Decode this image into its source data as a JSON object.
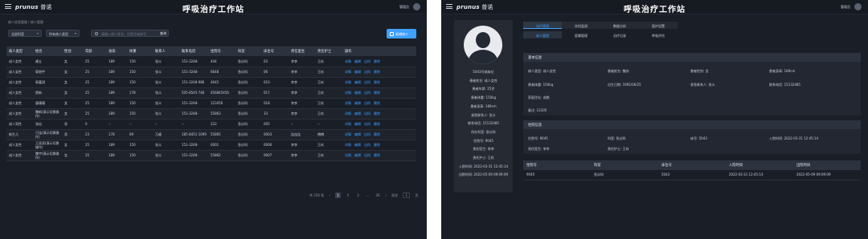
{
  "app": {
    "logo_main": "prunus",
    "logo_sub": "普诺",
    "title": "呼吸治疗工作站",
    "user": "管理员"
  },
  "list_page": {
    "breadcrumb": "病人信息管理 / 病人管理",
    "filter_dept": "全部科室",
    "filter_type": "所有病人类型",
    "search_placeholder": "请输入病人姓名、住院号或床号",
    "search_button": "查询",
    "add_button": "新增病人",
    "columns": [
      "病人类型",
      "姓名",
      "性别",
      "年龄",
      "身高",
      "体重",
      "联系人",
      "联系电话",
      "住院号",
      "科室",
      "床位号",
      "责任医生",
      "责任护士",
      "操作"
    ],
    "ops": [
      "详情",
      "编辑",
      "出科",
      "删除"
    ],
    "rows": [
      [
        "成人女性",
        "康五",
        "女",
        "25",
        "189",
        "150",
        "张义",
        "151-3248-",
        "444",
        "急诊科",
        "03",
        "李李",
        "王玖"
      ],
      [
        "成人女性",
        "郭朋宇",
        "女",
        "25",
        "189",
        "150",
        "张义",
        "151-3248-",
        "6648",
        "急诊科",
        "06",
        "李李",
        "王玖"
      ],
      [
        "成人女性",
        "郭嘉琪",
        "女",
        "25",
        "189",
        "150",
        "张义",
        "151-3248-986",
        "4645",
        "急诊科",
        "010",
        "李李",
        "王玖"
      ],
      [
        "成人女性",
        "贾新",
        "女",
        "25",
        "189",
        "178",
        "张义",
        "505-8545-746",
        "456845456",
        "急诊科",
        "017",
        "李李",
        "王玖"
      ],
      [
        "成人女性",
        "唐珊珊",
        "女",
        "25",
        "189",
        "150",
        "张义",
        "151-3248-",
        "123456",
        "急诊科",
        "018",
        "李李",
        "王玖"
      ],
      [
        "成人女性",
        "魏新(演示切换操作)",
        "女",
        "25",
        "189",
        "150",
        "张义",
        "151-3248-",
        "55863",
        "急诊科",
        "33",
        "李李",
        "王玖"
      ],
      [
        "成人男性",
        "张仙",
        "男",
        "0",
        "--",
        "--",
        "--",
        "--",
        "222",
        "急诊科",
        "005",
        "--",
        "--"
      ],
      [
        "新生儿",
        "只连(演示切换操作)",
        "男",
        "23",
        "178",
        "69",
        "万顺",
        "185-8451-1099",
        "55865",
        "急诊科",
        "0003",
        "连连连",
        "傅傅"
      ],
      [
        "成人女性",
        "王双双(演示切换操作)",
        "女",
        "25",
        "189",
        "150",
        "张义",
        "151-3248-",
        "0001",
        "急诊科",
        "0006",
        "李李",
        "王玖"
      ],
      [
        "成人女性",
        "魏宇(演示切换操作)",
        "女",
        "25",
        "189",
        "150",
        "张义",
        "151-3248-",
        "55862",
        "急诊科",
        "0007",
        "李李",
        "王玖"
      ]
    ],
    "pager": {
      "total": "共 256 条",
      "prev": "‹",
      "pages": [
        "1",
        "2",
        "3",
        "...",
        "26"
      ],
      "current": "1",
      "next": "›",
      "goto_label": "前往",
      "goto_value": "1",
      "goto_suffix": "页"
    }
  },
  "detail_page": {
    "profile": [
      "5043号病床位",
      "患者姓名: 成人女性",
      "患者年龄: 25岁",
      "患者体重: 150kg",
      "患者身高: 189cm",
      "紧急联系人: 张义",
      "联系电话: 15132485",
      "所在科室: 急诊科",
      "住院号: 9045",
      "责任医生: 李李",
      "责任护士: 王玖",
      "入院时间: 2022-03-31 12:45:14",
      "出院时间: 2022-05-09 09:09:09"
    ],
    "tabs_top": [
      "治疗管理",
      "实时监测",
      "数据分析",
      "医护设置"
    ],
    "tabs_sub": [
      "病人管理",
      "医嘱管理",
      "治疗记录",
      "呼吸评估"
    ],
    "basic_section": "基本信息",
    "basic_fields": [
      "病人类型: 成人女性",
      "患者姓名: 魏苏",
      "患者性别: 女",
      "患者身高: 189cm",
      "患者体重: 150kg",
      "出生日期: 1991/06/25",
      "紧急联系人: 张义",
      "联系电话: 15132485",
      "家庭住址: 成都",
      "备注: 13105"
    ],
    "hospital_section": "住院信息",
    "hospital_fields": [
      "住院号: 9045",
      "科室: 急诊科",
      "床号: 5043",
      "入院时间: 2022-03-31 12:45:14",
      "责任医生: 李李",
      "责任护士: 王玖"
    ],
    "record_columns": [
      "住院号",
      "科室",
      "床位号",
      "入院时间",
      "出院时间"
    ],
    "record_row": [
      "9045",
      "急诊科",
      "5043",
      "2022-03-31 12:45:14",
      "2022-05-09 09:09:09"
    ]
  }
}
